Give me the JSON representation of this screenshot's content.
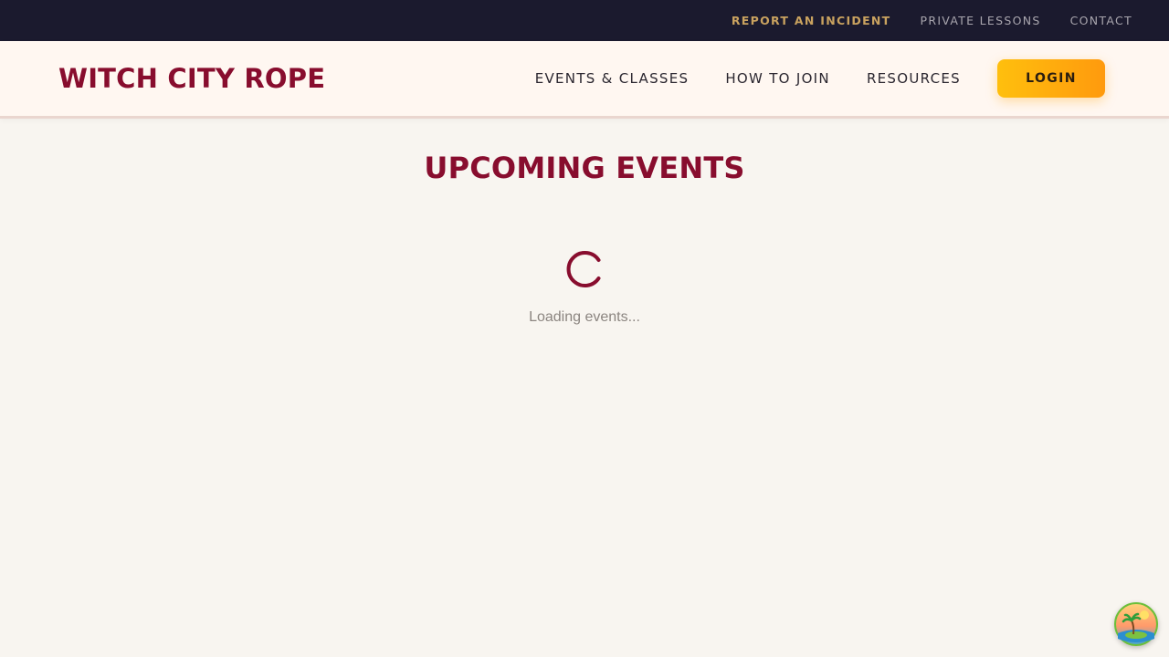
{
  "utility_nav": {
    "report_label": "REPORT AN INCIDENT",
    "private_lessons_label": "PRIVATE LESSONS",
    "contact_label": "CONTACT"
  },
  "header": {
    "logo_text": "WITCH CITY ROPE",
    "nav": {
      "events_label": "EVENTS & CLASSES",
      "join_label": "HOW TO JOIN",
      "resources_label": "RESOURCES"
    },
    "login_label": "LOGIN"
  },
  "main": {
    "title": "UPCOMING EVENTS",
    "loading_text": "Loading events...",
    "spinner_icon": "spinner-icon"
  },
  "floating_badge": {
    "icon": "island-palm-icon"
  },
  "colors": {
    "brand": "#880d2e",
    "utility_bar_bg": "#1b1a2e",
    "report_link": "#c9a25f",
    "login_gradient_start": "#ffbf0d",
    "login_gradient_end": "#ff9a0d",
    "page_bg": "#f8f5f0"
  }
}
